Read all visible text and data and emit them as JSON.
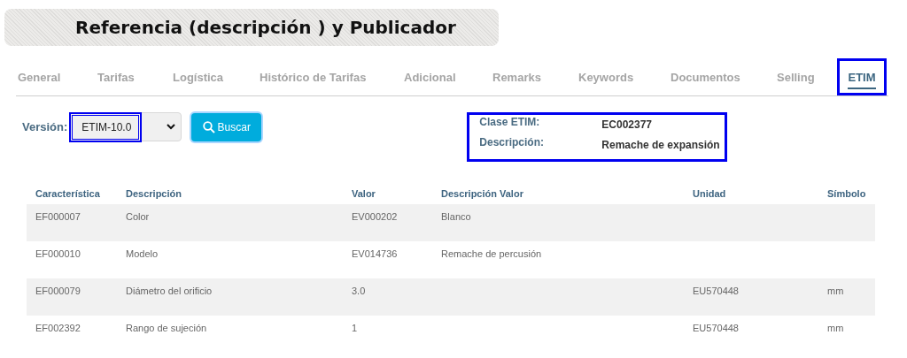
{
  "title": "Referencia (descripción ) y Publicador",
  "tabs": [
    {
      "label": "General",
      "selected": false,
      "highlighted": false
    },
    {
      "label": "Tarifas",
      "selected": false,
      "highlighted": false
    },
    {
      "label": "Logística",
      "selected": false,
      "highlighted": false
    },
    {
      "label": "Histórico de Tarifas",
      "selected": false,
      "highlighted": false
    },
    {
      "label": "Adicional",
      "selected": false,
      "highlighted": false
    },
    {
      "label": "Remarks",
      "selected": false,
      "highlighted": false
    },
    {
      "label": "Keywords",
      "selected": false,
      "highlighted": false
    },
    {
      "label": "Documentos",
      "selected": false,
      "highlighted": false
    },
    {
      "label": "Selling",
      "selected": false,
      "highlighted": false
    },
    {
      "label": "ETIM",
      "selected": true,
      "highlighted": true
    }
  ],
  "version": {
    "label": "Versión:",
    "value": "ETIM-10.0",
    "highlighted": true
  },
  "search_button": "Buscar",
  "class_info": {
    "highlighted": true,
    "fields": [
      {
        "label": "Clase ETIM:",
        "value": "EC002377"
      },
      {
        "label": "Descripción:",
        "value": "Remache de expansión"
      }
    ]
  },
  "table": {
    "columns": [
      "Característica",
      "Descripción",
      "Valor",
      "Descripción Valor",
      "Unidad",
      "Símbolo"
    ],
    "rows": [
      [
        "EF000007",
        "Color",
        "EV000202",
        "Blanco",
        "",
        ""
      ],
      [
        "EF000010",
        "Modelo",
        "EV014736",
        "Remache de percusión",
        "",
        ""
      ],
      [
        "EF000079",
        "Diámetro del orificio",
        "3.0",
        "",
        "EU570448",
        "mm"
      ],
      [
        "EF002392",
        "Rango de sujeción",
        "1",
        "",
        "EU570448",
        "mm"
      ]
    ]
  }
}
